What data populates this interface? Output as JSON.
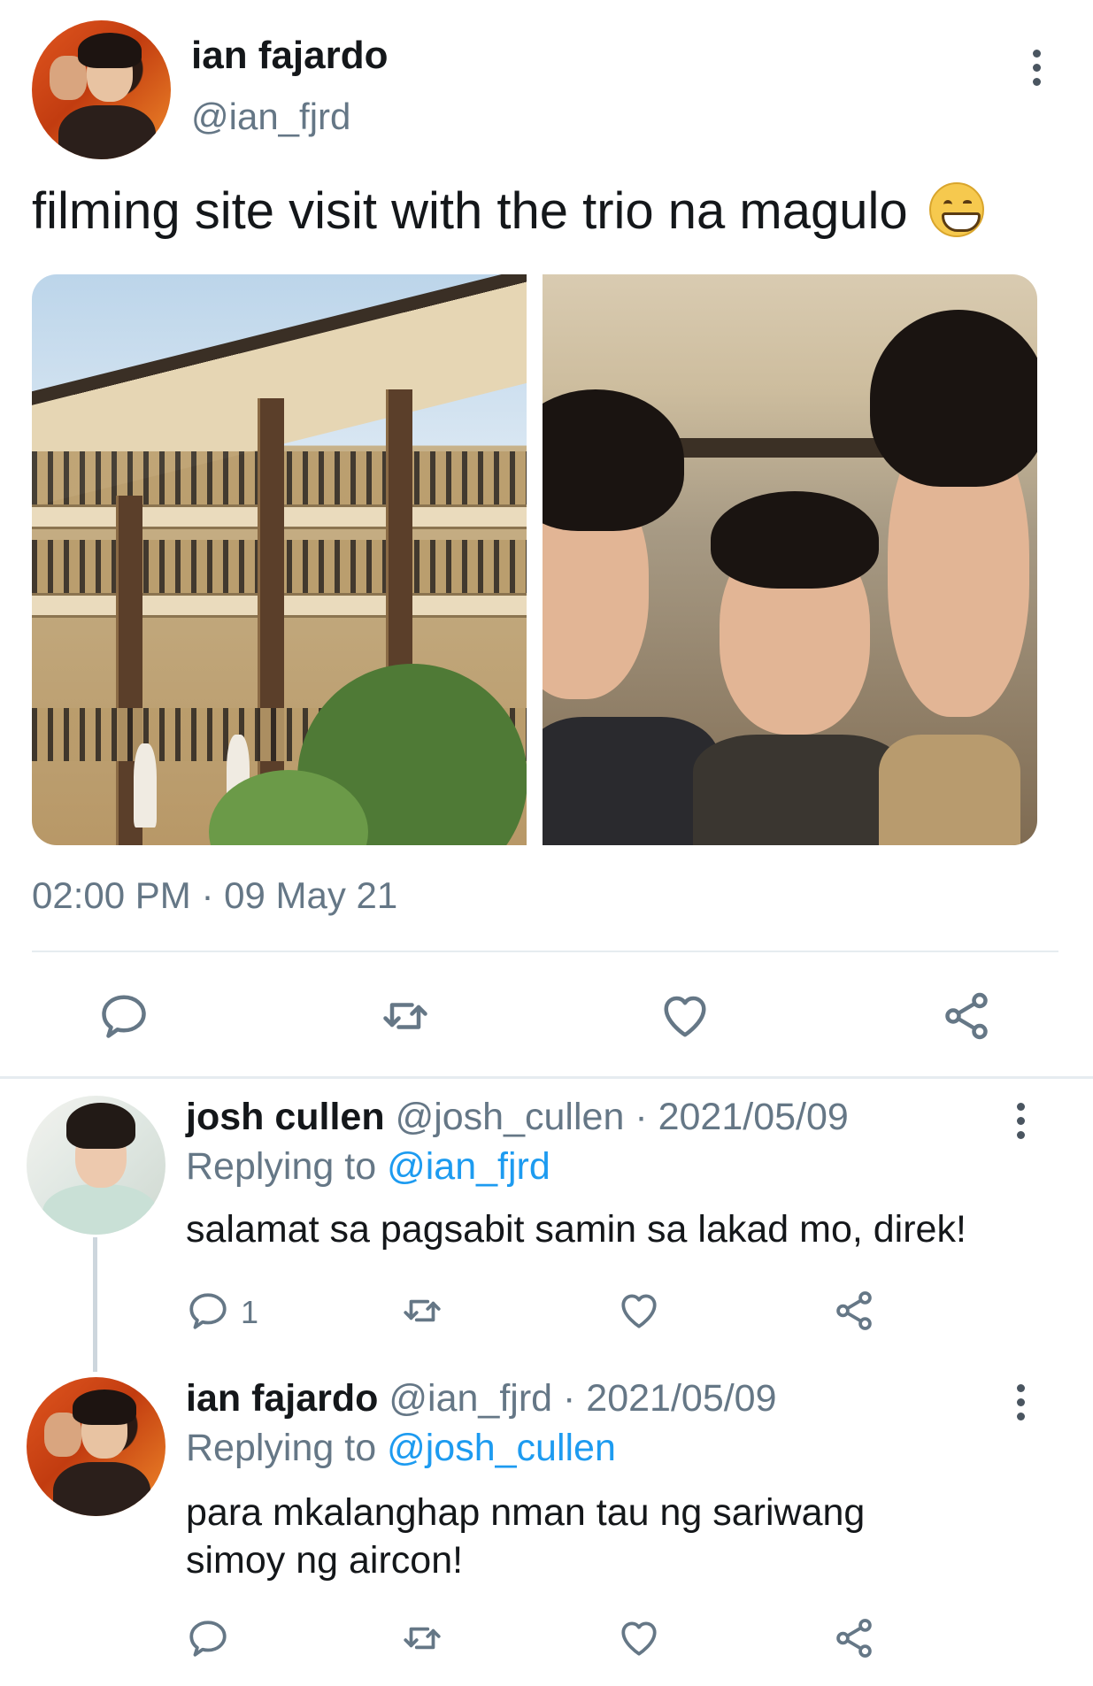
{
  "tweet": {
    "author_name": "ian fajardo",
    "author_handle": "@ian_fjrd",
    "text": "filming site visit with the trio na magulo",
    "emoji": "grinning-face-with-smiling-eyes",
    "timestamp": "02:00 PM · 09 May 21",
    "actions": [
      "reply-icon",
      "retweet-icon",
      "like-icon",
      "share-icon"
    ]
  },
  "replies": [
    {
      "author_name": "josh cullen",
      "author_handle": "@josh_cullen",
      "separator": " · ",
      "date": "2021/05/09",
      "replying_label": "Replying to ",
      "replying_to": "@ian_fjrd",
      "text": "salamat sa pagsabit samin sa lakad mo, direk!",
      "reply_count": "1"
    },
    {
      "author_name": "ian fajardo",
      "author_handle": "@ian_fjrd",
      "separator": " · ",
      "date": "2021/05/09",
      "replying_label": "Replying to ",
      "replying_to": "@josh_cullen",
      "text_line1": "para mkalanghap nman tau ng sariwang",
      "text_line2": "simoy ng aircon!"
    }
  ],
  "colors": {
    "text": "#14171a",
    "muted": "#657786",
    "link": "#1d9bf0",
    "divider": "#e6ecf0"
  }
}
